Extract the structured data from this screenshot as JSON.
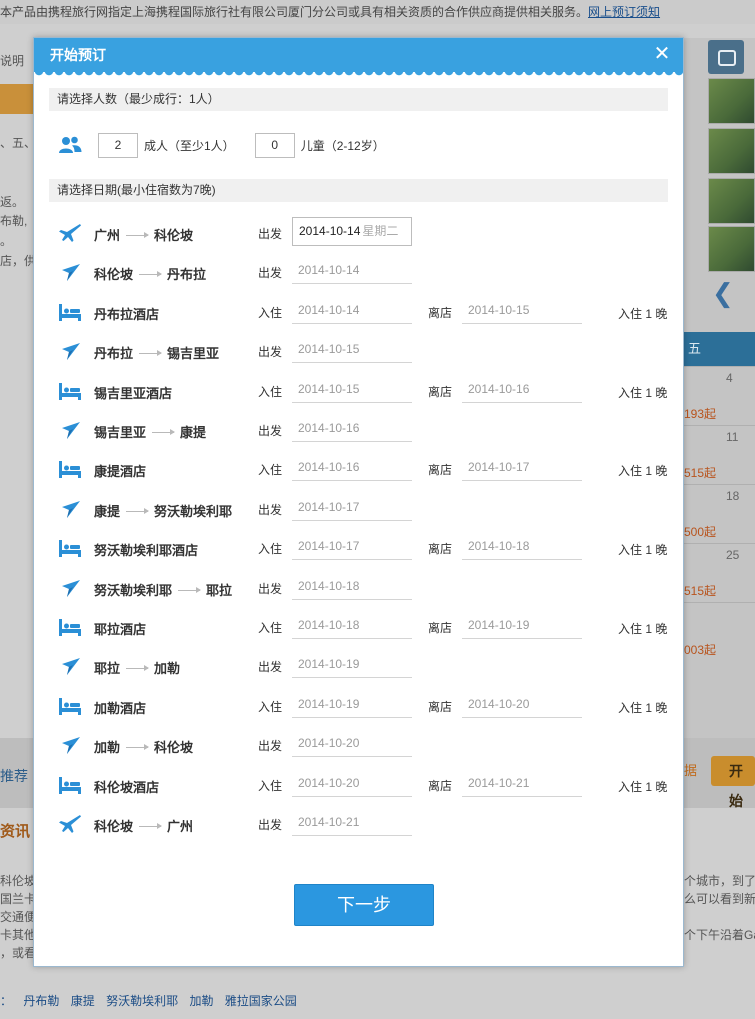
{
  "background": {
    "top_notice": "本产品由携程旅行网指定上海携程国际旅行社有限公司厦门分公司或具有相关资质的合作供应商提供相关服务。",
    "top_notice_link": "网上预订须知",
    "left_fragments": [
      "说明",
      "、五、",
      "返。",
      "布勒,",
      "。",
      "店，供"
    ],
    "calendar_header": "五",
    "calendar_days": [
      "4",
      "11",
      "18",
      "25"
    ],
    "calendar_prices": [
      "193起",
      "515起",
      "500起",
      "515起",
      "003起"
    ],
    "recommend_label": "推荐",
    "right_button_1": "据",
    "right_button_2": "开始",
    "info_heading": "资讯",
    "paragraph_left": [
      "科伦坡",
      "国兰卡",
      "交通便",
      "卡其他",
      "，或看"
    ],
    "paragraph_right": [
      "个城市，到了",
      "么可以看到新建",
      "个下午沿着Ga"
    ],
    "bottom_links_prefix": "：",
    "bottom_links": [
      "丹布勒",
      "康提",
      "努沃勒埃利耶",
      "加勒",
      "雅拉国家公园"
    ]
  },
  "modal": {
    "title": "开始预订",
    "close_symbol": "✕",
    "people_section_title": "请选择人数（最少成行：1人）",
    "adults_value": "2",
    "adults_label": "成人（至少1人）",
    "children_value": "0",
    "children_label": "儿童（2-12岁）",
    "date_section_title": "请选择日期(最小住宿数为7晚)",
    "depart_label": "出发",
    "checkin_label": "入住",
    "checkout_label": "离店",
    "nights_label": "入住 1 晚",
    "first_weekday": "星期二",
    "next_button": "下一步",
    "rows": [
      {
        "type": "flight",
        "from": "广州",
        "to": "科伦坡",
        "date": "2014-10-14"
      },
      {
        "type": "transfer",
        "from": "科伦坡",
        "to": "丹布拉",
        "date": "2014-10-14"
      },
      {
        "type": "hotel",
        "name": "丹布拉酒店",
        "checkin": "2014-10-14",
        "checkout": "2014-10-15"
      },
      {
        "type": "transfer",
        "from": "丹布拉",
        "to": "锡吉里亚",
        "date": "2014-10-15"
      },
      {
        "type": "hotel",
        "name": "锡吉里亚酒店",
        "checkin": "2014-10-15",
        "checkout": "2014-10-16"
      },
      {
        "type": "transfer",
        "from": "锡吉里亚",
        "to": "康提",
        "date": "2014-10-16"
      },
      {
        "type": "hotel",
        "name": "康提酒店",
        "checkin": "2014-10-16",
        "checkout": "2014-10-17"
      },
      {
        "type": "transfer",
        "from": "康提",
        "to": "努沃勒埃利耶",
        "date": "2014-10-17"
      },
      {
        "type": "hotel",
        "name": "努沃勒埃利耶酒店",
        "checkin": "2014-10-17",
        "checkout": "2014-10-18"
      },
      {
        "type": "transfer",
        "from": "努沃勒埃利耶",
        "to": "耶拉",
        "date": "2014-10-18"
      },
      {
        "type": "hotel",
        "name": "耶拉酒店",
        "checkin": "2014-10-18",
        "checkout": "2014-10-19"
      },
      {
        "type": "transfer",
        "from": "耶拉",
        "to": "加勒",
        "date": "2014-10-19"
      },
      {
        "type": "hotel",
        "name": "加勒酒店",
        "checkin": "2014-10-19",
        "checkout": "2014-10-20"
      },
      {
        "type": "transfer",
        "from": "加勒",
        "to": "科伦坡",
        "date": "2014-10-20"
      },
      {
        "type": "hotel",
        "name": "科伦坡酒店",
        "checkin": "2014-10-20",
        "checkout": "2014-10-21"
      },
      {
        "type": "flight",
        "from": "科伦坡",
        "to": "广州",
        "date": "2014-10-21"
      }
    ]
  },
  "colors": {
    "header_blue": "#39a1e0",
    "icon_blue": "#2b8fd6",
    "button_blue": "#2b97e0",
    "section_grey": "#f0f0f0"
  },
  "icons": {
    "people": "people-icon",
    "flight": "airplane-icon",
    "transfer": "transfer-arrow-icon",
    "hotel": "bed-icon",
    "close": "close-icon",
    "camera": "camera-icon"
  }
}
